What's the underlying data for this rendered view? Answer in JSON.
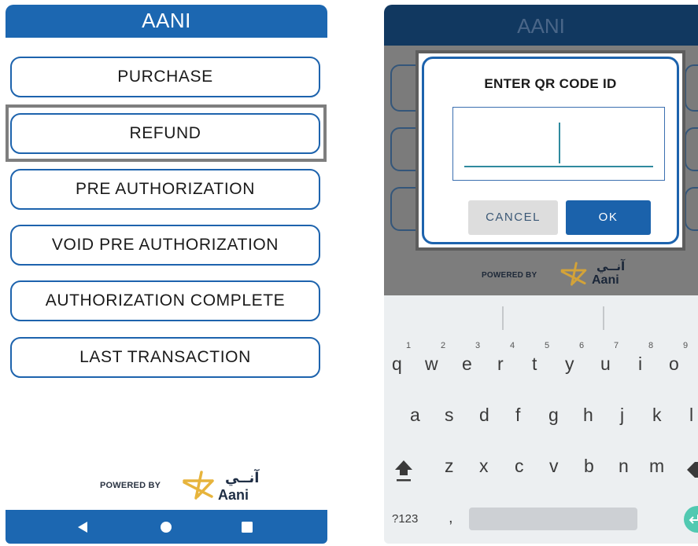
{
  "left": {
    "header": {
      "title": "AANI"
    },
    "menu": [
      {
        "label": "PURCHASE"
      },
      {
        "label": "REFUND"
      },
      {
        "label": "PRE AUTHORIZATION"
      },
      {
        "label": "VOID PRE AUTHORIZATION"
      },
      {
        "label": "AUTHORIZATION COMPLETE"
      },
      {
        "label": "LAST TRANSACTION"
      }
    ],
    "focused_item": "REFUND",
    "powered_by": "POWERED BY",
    "brand": {
      "arabic": "آنــي",
      "latin": "Aani"
    },
    "nav": {
      "icons": [
        "back-icon",
        "home-icon",
        "recents-icon"
      ]
    }
  },
  "right": {
    "header": {
      "title": "AANI"
    },
    "dialog": {
      "title": "ENTER QR CODE ID",
      "input_value": "",
      "cancel_label": "CANCEL",
      "ok_label": "OK"
    },
    "powered_by": "POWERED BY",
    "brand": {
      "arabic": "آنــي",
      "latin": "Aani"
    },
    "keyboard": {
      "row1": [
        "q",
        "w",
        "e",
        "r",
        "t",
        "y",
        "u",
        "i",
        "o"
      ],
      "row1_hints": [
        "1",
        "2",
        "3",
        "4",
        "5",
        "6",
        "7",
        "8",
        "9"
      ],
      "row2": [
        "a",
        "s",
        "d",
        "f",
        "g",
        "h",
        "j",
        "k",
        "l"
      ],
      "row3": [
        "z",
        "x",
        "c",
        "v",
        "b",
        "n",
        "m"
      ],
      "symbols_label": "?123",
      "comma": ","
    }
  },
  "colors": {
    "brand_blue": "#1c67b1",
    "dark_header": "#113860",
    "ok_blue": "#1b62ab",
    "enter_key": "#51c9b1",
    "logo_gold": "#e7b43c"
  }
}
